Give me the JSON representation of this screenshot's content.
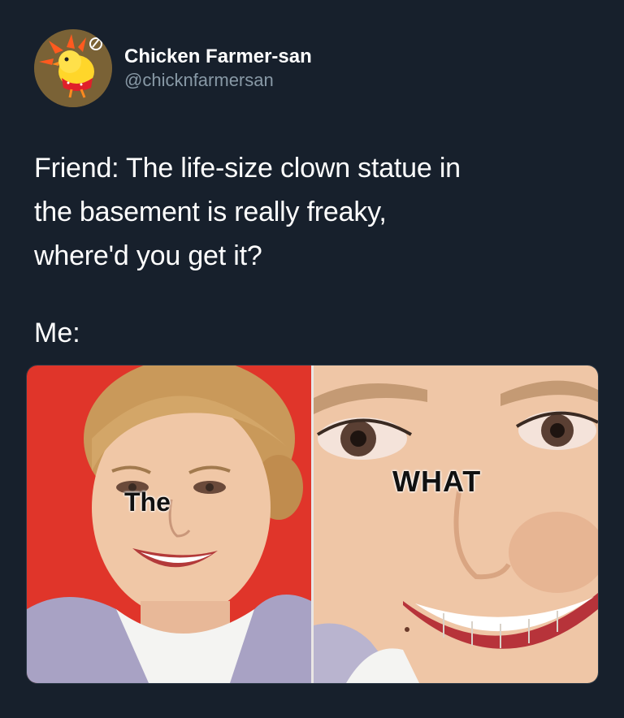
{
  "author": {
    "display_name": "Chicken Farmer-san",
    "handle": "@chicknfarmersan",
    "avatar_icon": "chicken-avatar-icon"
  },
  "tweet": {
    "lines": [
      "Friend: The life-size clown statue in",
      "the basement is really freaky,",
      "where'd you get it?"
    ],
    "reply_line": "Me:"
  },
  "meme": {
    "left_caption": "The",
    "right_caption": "WHAT"
  },
  "colors": {
    "background": "#17202c",
    "secondary_text": "#8899a6",
    "left_panel_bg": "#e0352a"
  }
}
